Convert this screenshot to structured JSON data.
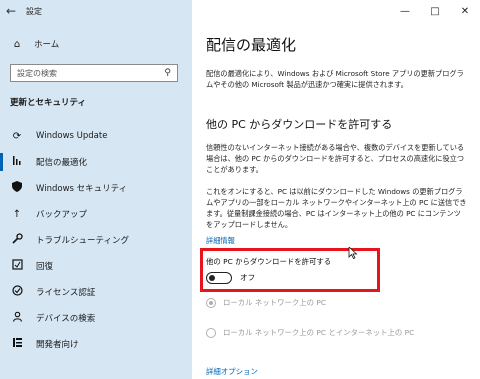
{
  "window": {
    "title": "設定",
    "back_icon": "arrow-left-icon",
    "controls": [
      "minimize-icon",
      "maximize-icon",
      "close-icon"
    ]
  },
  "sidebar": {
    "home_label": "ホーム",
    "search_placeholder": "設定の検索",
    "section_title": "更新とセキュリティ",
    "items": [
      {
        "label": "Windows Update",
        "icon": "sync-icon",
        "active": false
      },
      {
        "label": "配信の最適化",
        "icon": "delivery-optimization-icon",
        "active": true
      },
      {
        "label": "Windows セキュリティ",
        "icon": "shield-icon",
        "active": false
      },
      {
        "label": "バックアップ",
        "icon": "backup-arrow-icon",
        "active": false
      },
      {
        "label": "トラブルシューティング",
        "icon": "wrench-icon",
        "active": false
      },
      {
        "label": "回復",
        "icon": "recovery-icon",
        "active": false
      },
      {
        "label": "ライセンス認証",
        "icon": "check-circle-icon",
        "active": false
      },
      {
        "label": "デバイスの検索",
        "icon": "person-pin-icon",
        "active": false
      },
      {
        "label": "開発者向け",
        "icon": "developer-icon",
        "active": false
      }
    ]
  },
  "main": {
    "title": "配信の最適化",
    "description": "配信の最適化により、Windows および Microsoft Store アプリの更新プログラムやその他の Microsoft 製品が迅速かつ確実に提供されます。",
    "section_heading": "他の PC からダウンロードを許可する",
    "para1": "信頼性のないインターネット接続がある場合や、複数のデバイスを更新している場合は、他の PC からのダウンロードを許可すると、プロセスの高速化に役立つことがあります。",
    "para2": "これをオンにすると、PC は以前にダウンロードした Windows の更新プログラムやアプリの一部をローカル ネットワークやインターネット上の PC に送信できます。従量制課金接続の場合、PC はインターネット上の他の PC にコンテンツをアップロードしません。",
    "details_link": "詳細情報",
    "toggle_label": "他の PC からダウンロードを許可する",
    "toggle_state": "オフ",
    "toggle_on": false,
    "radio1": "ローカル ネットワーク上の PC",
    "radio2": "ローカル ネットワーク上の PC とインターネット上の PC",
    "advanced_link": "詳細オプション"
  },
  "colors": {
    "sidebar_bg": "#d6e6f3",
    "accent": "#0063b1",
    "highlight_border": "#e8141b"
  }
}
